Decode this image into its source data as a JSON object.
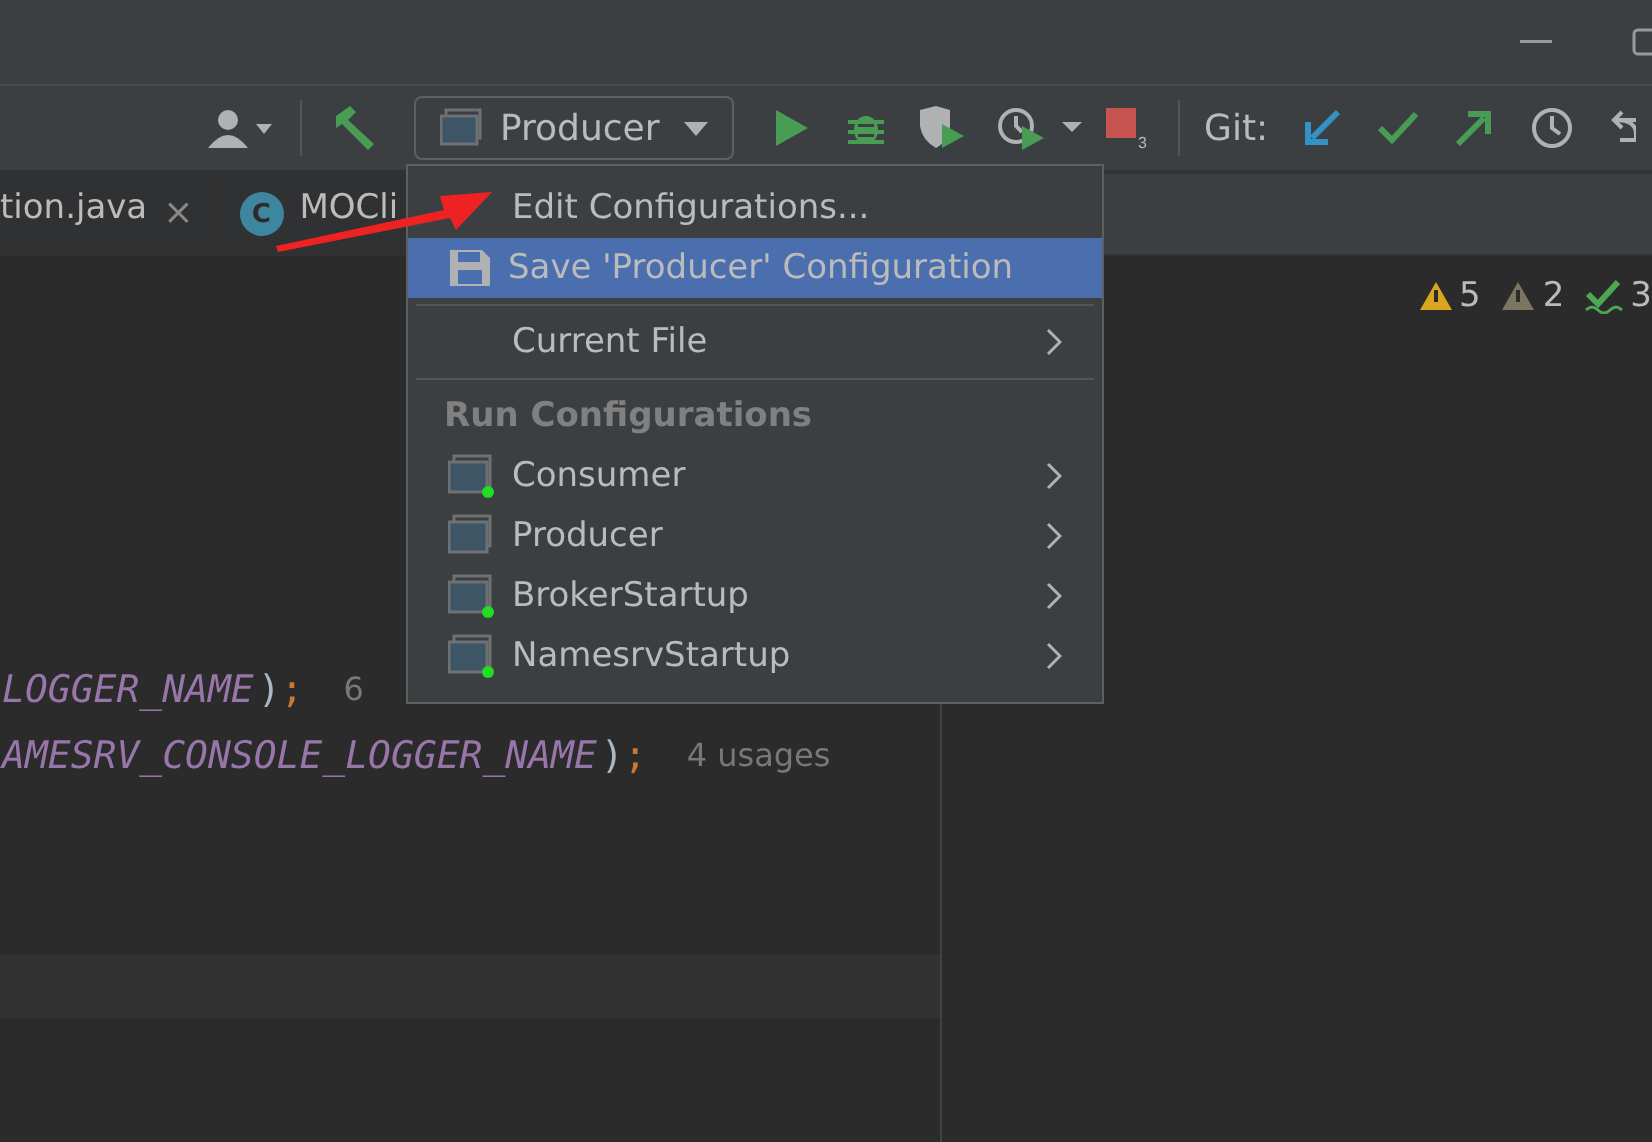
{
  "toolbar": {
    "run_config": "Producer",
    "stop_badge": "3",
    "git_label": "Git:"
  },
  "tabs": [
    {
      "label": "tion.java",
      "close_glyph": "×"
    },
    {
      "label": "MOCli",
      "icon_letter": "C"
    }
  ],
  "inspections": [
    {
      "kind": "warning",
      "count": "5"
    },
    {
      "kind": "weak_warning",
      "count": "2"
    },
    {
      "kind": "typo",
      "count": "3"
    }
  ],
  "code_lines": [
    {
      "tokens": [
        {
          "kind": "constant",
          "text": "LOGGER_NAME"
        },
        {
          "kind": "paren",
          "text": ")"
        },
        {
          "kind": "semi",
          "text": ";"
        }
      ],
      "hint": "6"
    },
    {
      "tokens": [
        {
          "kind": "constant",
          "text": "AMESRV_CONSOLE_LOGGER_NAME"
        },
        {
          "kind": "paren",
          "text": ")"
        },
        {
          "kind": "semi",
          "text": ";"
        }
      ],
      "hint": "4 usages"
    }
  ],
  "menu": {
    "items": [
      {
        "kind": "action",
        "label": "Edit Configurations...",
        "selected": false
      },
      {
        "kind": "save",
        "label": "Save 'Producer' Configuration",
        "selected": true
      },
      {
        "kind": "separator"
      },
      {
        "kind": "submenu",
        "label": "Current File",
        "selected": false
      },
      {
        "kind": "separator"
      },
      {
        "kind": "header",
        "label": "Run Configurations"
      },
      {
        "kind": "config",
        "label": "Consumer",
        "running": true,
        "selected": false
      },
      {
        "kind": "config",
        "label": "Producer",
        "running": false,
        "selected": false
      },
      {
        "kind": "config",
        "label": "BrokerStartup",
        "running": true,
        "selected": false
      },
      {
        "kind": "config",
        "label": "NamesrvStartup",
        "running": true,
        "selected": false
      }
    ]
  }
}
